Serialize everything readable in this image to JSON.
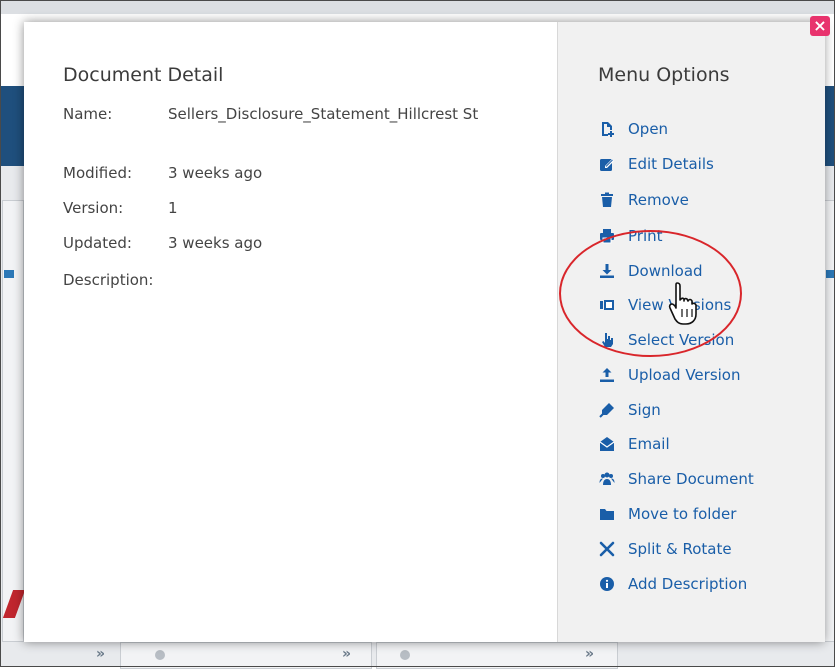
{
  "detail": {
    "title": "Document Detail",
    "name_label": "Name:",
    "name_value": "Sellers_Disclosure_Statement_Hillcrest St",
    "modified_label": "Modified:",
    "modified_value": "3 weeks ago",
    "version_label": "Version:",
    "version_value": "1",
    "updated_label": "Updated:",
    "updated_value": "3 weeks ago",
    "description_label": "Description:"
  },
  "menu": {
    "title": "Menu Options",
    "items": [
      {
        "label": "Open",
        "icon": "open-file-icon"
      },
      {
        "label": "Edit Details",
        "icon": "edit-icon"
      },
      {
        "label": "Remove",
        "icon": "trash-icon"
      },
      {
        "label": "Print",
        "icon": "print-icon"
      },
      {
        "label": "Download",
        "icon": "download-icon"
      },
      {
        "label": "View Versions",
        "icon": "versions-icon"
      },
      {
        "label": "Select Version",
        "icon": "pointer-icon"
      },
      {
        "label": "Upload Version",
        "icon": "upload-icon"
      },
      {
        "label": "Sign",
        "icon": "pen-icon"
      },
      {
        "label": "Email",
        "icon": "envelope-icon"
      },
      {
        "label": "Share Document",
        "icon": "users-icon"
      },
      {
        "label": "Move to folder",
        "icon": "folder-icon"
      },
      {
        "label": "Split & Rotate",
        "icon": "split-icon"
      },
      {
        "label": "Add Description",
        "icon": "info-icon"
      }
    ]
  },
  "close": {
    "symbol": "×"
  },
  "colors": {
    "accent": "#1a5ea8",
    "close": "#e8336d",
    "annotation": "#d9262b"
  }
}
